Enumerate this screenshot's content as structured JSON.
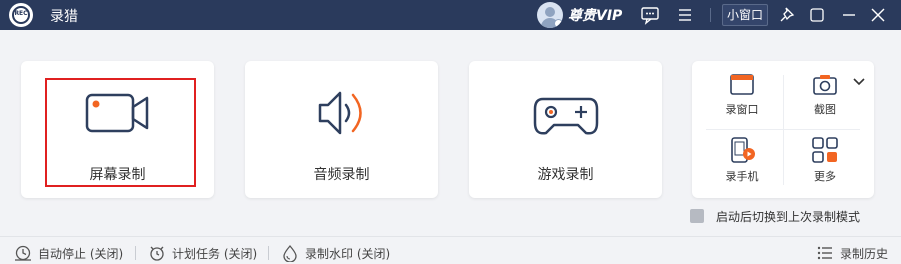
{
  "app": {
    "title": "录猎",
    "logo_text": "REC"
  },
  "titlebar": {
    "vip_label": "尊贵VIP",
    "mini_window_label": "小窗口"
  },
  "cards": [
    {
      "label": "屏幕录制",
      "icon": "camera-icon",
      "selected": true
    },
    {
      "label": "音频录制",
      "icon": "speaker-icon",
      "selected": false
    },
    {
      "label": "游戏录制",
      "icon": "gamepad-icon",
      "selected": false
    }
  ],
  "tools": {
    "items": [
      {
        "label": "录窗口",
        "icon": "window-record-icon"
      },
      {
        "label": "截图",
        "icon": "screenshot-icon"
      },
      {
        "label": "录手机",
        "icon": "phone-record-icon"
      },
      {
        "label": "更多",
        "icon": "more-grid-icon"
      }
    ]
  },
  "startup_option": {
    "label": "启动后切换到上次录制模式",
    "checked": false
  },
  "bottom": {
    "auto_stop": "自动停止 (关闭)",
    "schedule": "计划任务 (关闭)",
    "watermark": "录制水印 (关闭)",
    "history": "录制历史"
  },
  "colors": {
    "titlebar": "#2a3a5c",
    "accent": "#f26522",
    "icon_stroke": "#2e3f5e",
    "selection": "#e02020"
  }
}
